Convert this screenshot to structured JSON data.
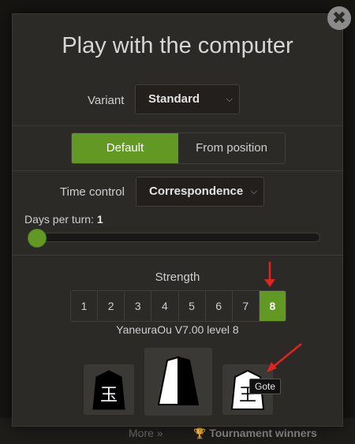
{
  "background": {
    "more_link": "More »",
    "tournament_label": "Tournament winners"
  },
  "modal": {
    "title": "Play with the computer",
    "close_glyph": "✖",
    "variant": {
      "label": "Variant",
      "value": "Standard"
    },
    "modes": [
      {
        "label": "Default",
        "active": true
      },
      {
        "label": "From position",
        "active": false
      }
    ],
    "time_control": {
      "label": "Time control",
      "value": "Correspondence"
    },
    "days_per_turn": {
      "label": "Days per turn:",
      "value": "1"
    },
    "strength": {
      "label": "Strength",
      "levels": [
        "1",
        "2",
        "3",
        "4",
        "5",
        "6",
        "7",
        "8"
      ],
      "selected": "8"
    },
    "engine_text": "YaneuraOu V7.00 level 8",
    "colors": {
      "sente_glyph": "玉",
      "gote_glyph": "王",
      "gote_tooltip": "Gote"
    }
  },
  "accent_color": "#629924",
  "annotation_color": "#e0241f"
}
